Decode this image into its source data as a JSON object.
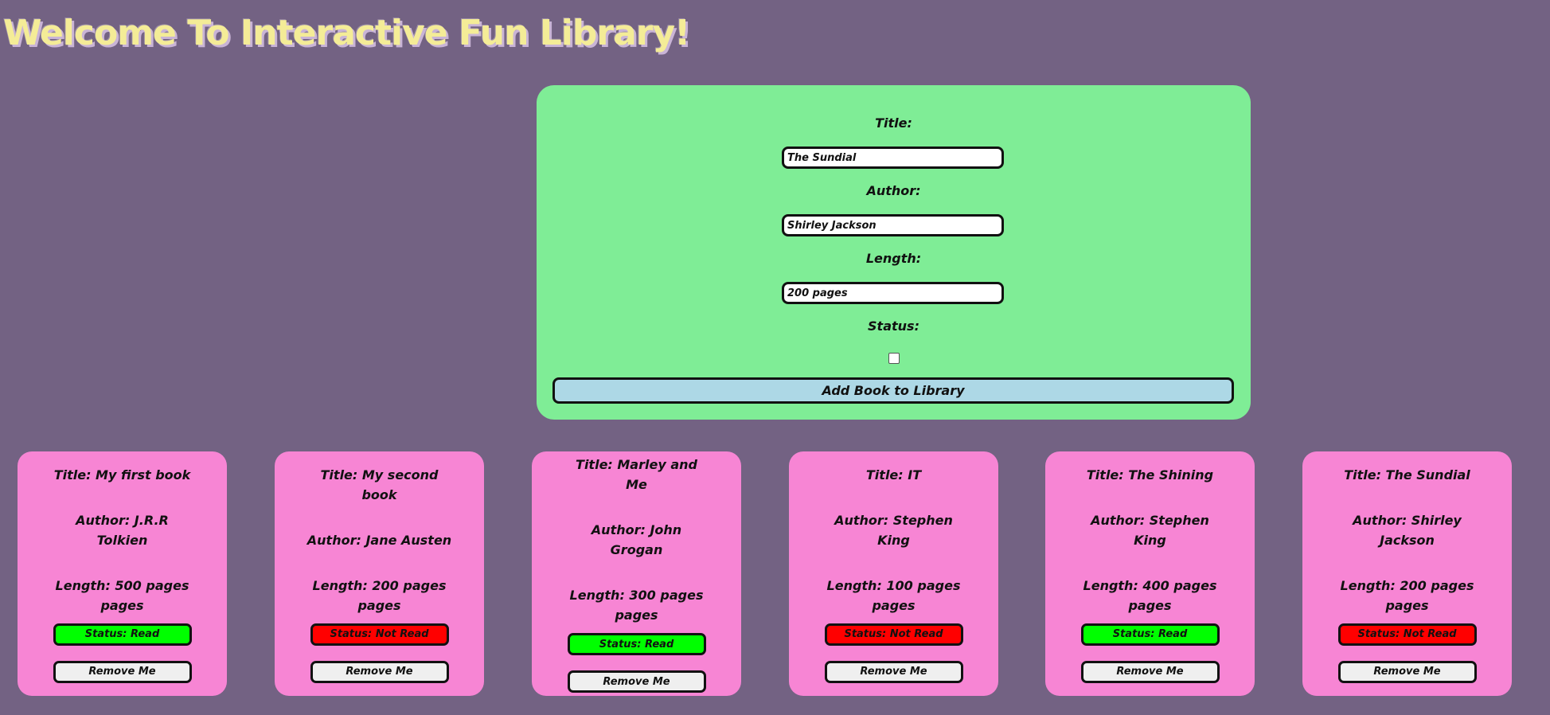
{
  "header": {
    "title": "Welcome To Interactive Fun Library!"
  },
  "form": {
    "title_label": "Title:",
    "title_value": "The Sundial",
    "author_label": "Author:",
    "author_value": "Shirley Jackson",
    "length_label": "Length:",
    "length_value": "200 pages",
    "status_label": "Status:",
    "status_checked": false,
    "add_button": "Add Book to Library"
  },
  "colors": {
    "background": "#736283",
    "form_panel": "#7fed96",
    "card": "#f785d4",
    "status_read": "#00ff00",
    "status_not_read": "#ff0000",
    "add_button": "#add8e6",
    "title_text": "#f4ec97"
  },
  "books": [
    {
      "title": "Title: My first book",
      "author": "Author: J.R.R Tolkien",
      "length": "Length: 500 pages pages",
      "status": "Status: Read",
      "read": true,
      "remove": "Remove Me"
    },
    {
      "title": "Title: My second book",
      "author": "Author: Jane Austen",
      "length": "Length: 200 pages pages",
      "status": "Status: Not Read",
      "read": false,
      "remove": "Remove Me"
    },
    {
      "title": "Title: Marley and Me",
      "author": "Author: John Grogan",
      "length": "Length: 300 pages pages",
      "status": "Status: Read",
      "read": true,
      "remove": "Remove Me"
    },
    {
      "title": "Title: IT",
      "author": "Author: Stephen King",
      "length": "Length: 100 pages pages",
      "status": "Status: Not Read",
      "read": false,
      "remove": "Remove Me"
    },
    {
      "title": "Title: The Shining",
      "author": "Author: Stephen King",
      "length": "Length: 400 pages pages",
      "status": "Status: Read",
      "read": true,
      "remove": "Remove Me"
    },
    {
      "title": "Title: The Sundial",
      "author": "Author: Shirley Jackson",
      "length": "Length: 200 pages pages",
      "status": "Status: Not Read",
      "read": false,
      "remove": "Remove Me"
    }
  ]
}
